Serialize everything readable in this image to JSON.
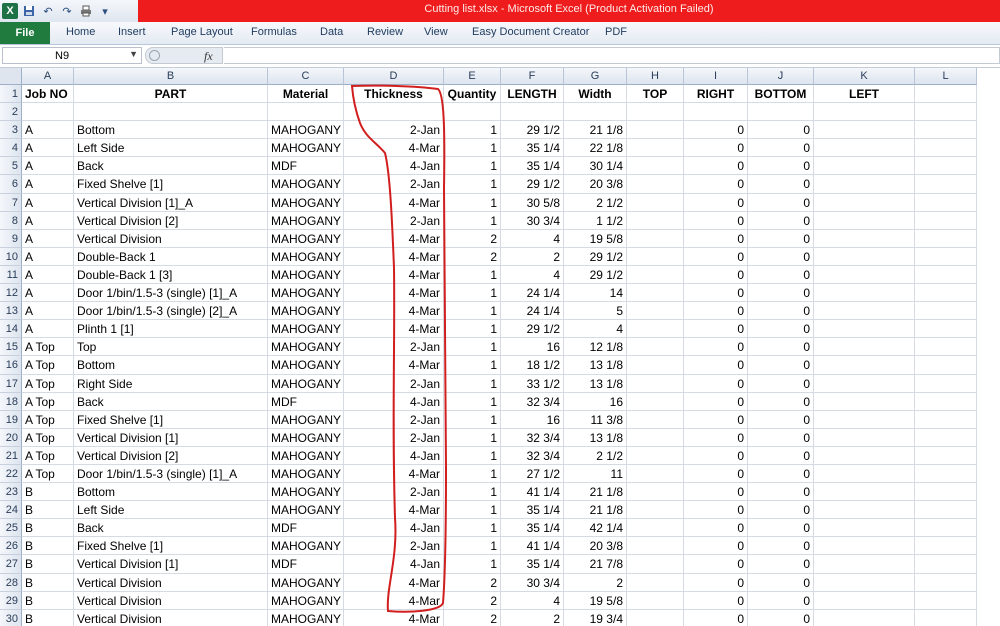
{
  "window": {
    "title": "Cutting list.xlsx  -  Microsoft Excel (Product Activation Failed)"
  },
  "app": {
    "logo": "X"
  },
  "qat": {
    "icons": [
      "save-icon",
      "undo-icon",
      "redo-icon",
      "print-icon",
      "customize-icon"
    ]
  },
  "ribbon": {
    "file": "File",
    "tabs": [
      "Home",
      "Insert",
      "Page Layout",
      "Formulas",
      "Data",
      "Review",
      "View",
      "Easy Document Creator",
      "PDF"
    ]
  },
  "formula_bar": {
    "name_box": "N9",
    "fx": "fx",
    "value": ""
  },
  "columns": [
    "A",
    "B",
    "C",
    "D",
    "E",
    "F",
    "G",
    "H",
    "I",
    "J",
    "K",
    "L"
  ],
  "header_row": [
    "Job NO",
    "PART",
    "Material",
    "Thickness",
    "Quantity",
    "LENGTH",
    "Width",
    "TOP",
    "RIGHT",
    "BOTTOM",
    "LEFT",
    ""
  ],
  "rows": [
    {
      "n": "1"
    },
    {
      "n": "2",
      "cells": [
        "",
        "",
        "",
        "",
        "",
        "",
        "",
        "",
        "",
        "",
        "",
        ""
      ]
    },
    {
      "n": "3",
      "cells": [
        "A",
        "Bottom",
        "MAHOGANY",
        "2-Jan",
        "1",
        "29 1/2",
        "21 1/8",
        "",
        "0",
        "0",
        "",
        ""
      ]
    },
    {
      "n": "4",
      "cells": [
        "A",
        "Left Side",
        "MAHOGANY",
        "4-Mar",
        "1",
        "35 1/4",
        "22 1/8",
        "",
        "0",
        "0",
        "",
        ""
      ]
    },
    {
      "n": "5",
      "cells": [
        "A",
        "Back",
        "MDF",
        "4-Jan",
        "1",
        "35 1/4",
        "30 1/4",
        "",
        "0",
        "0",
        "",
        ""
      ]
    },
    {
      "n": "6",
      "cells": [
        "A",
        "Fixed Shelve [1]",
        "MAHOGANY",
        "2-Jan",
        "1",
        "29 1/2",
        "20 3/8",
        "",
        "0",
        "0",
        "",
        ""
      ]
    },
    {
      "n": "7",
      "cells": [
        "A",
        "Vertical Division [1]_A",
        "MAHOGANY",
        "4-Mar",
        "1",
        "30 5/8",
        "2 1/2",
        "",
        "0",
        "0",
        "",
        ""
      ]
    },
    {
      "n": "8",
      "cells": [
        "A",
        "Vertical Division [2]",
        "MAHOGANY",
        "2-Jan",
        "1",
        "30 3/4",
        "1 1/2",
        "",
        "0",
        "0",
        "",
        ""
      ]
    },
    {
      "n": "9",
      "cells": [
        "A",
        "Vertical Division",
        "MAHOGANY",
        "4-Mar",
        "2",
        "4",
        "19 5/8",
        "",
        "0",
        "0",
        "",
        ""
      ]
    },
    {
      "n": "10",
      "cells": [
        "A",
        "Double-Back 1",
        "MAHOGANY",
        "4-Mar",
        "2",
        "2",
        "29 1/2",
        "",
        "0",
        "0",
        "",
        ""
      ]
    },
    {
      "n": "11",
      "cells": [
        "A",
        "Double-Back 1 [3]",
        "MAHOGANY",
        "4-Mar",
        "1",
        "4",
        "29 1/2",
        "",
        "0",
        "0",
        "",
        ""
      ]
    },
    {
      "n": "12",
      "cells": [
        "A",
        "Door 1/bin/1.5-3 (single) [1]_A",
        "MAHOGANY",
        "4-Mar",
        "1",
        "24 1/4",
        "14",
        "",
        "0",
        "0",
        "",
        ""
      ]
    },
    {
      "n": "13",
      "cells": [
        "A",
        "Door 1/bin/1.5-3 (single) [2]_A",
        "MAHOGANY",
        "4-Mar",
        "1",
        "24 1/4",
        "5",
        "",
        "0",
        "0",
        "",
        ""
      ]
    },
    {
      "n": "14",
      "cells": [
        "A",
        "Plinth 1 [1]",
        "MAHOGANY",
        "4-Mar",
        "1",
        "29 1/2",
        "4",
        "",
        "0",
        "0",
        "",
        ""
      ]
    },
    {
      "n": "15",
      "cells": [
        "A Top",
        "Top",
        "MAHOGANY",
        "2-Jan",
        "1",
        "16",
        "12 1/8",
        "",
        "0",
        "0",
        "",
        ""
      ]
    },
    {
      "n": "16",
      "cells": [
        "A Top",
        "Bottom",
        "MAHOGANY",
        "4-Mar",
        "1",
        "18 1/2",
        "13 1/8",
        "",
        "0",
        "0",
        "",
        ""
      ]
    },
    {
      "n": "17",
      "cells": [
        "A Top",
        "Right Side",
        "MAHOGANY",
        "2-Jan",
        "1",
        "33 1/2",
        "13 1/8",
        "",
        "0",
        "0",
        "",
        ""
      ]
    },
    {
      "n": "18",
      "cells": [
        "A Top",
        "Back",
        "MDF",
        "4-Jan",
        "1",
        "32 3/4",
        "16",
        "",
        "0",
        "0",
        "",
        ""
      ]
    },
    {
      "n": "19",
      "cells": [
        "A Top",
        "Fixed Shelve [1]",
        "MAHOGANY",
        "2-Jan",
        "1",
        "16",
        "11 3/8",
        "",
        "0",
        "0",
        "",
        ""
      ]
    },
    {
      "n": "20",
      "cells": [
        "A Top",
        "Vertical Division [1]",
        "MAHOGANY",
        "2-Jan",
        "1",
        "32 3/4",
        "13 1/8",
        "",
        "0",
        "0",
        "",
        ""
      ]
    },
    {
      "n": "21",
      "cells": [
        "A Top",
        "Vertical Division [2]",
        "MAHOGANY",
        "4-Jan",
        "1",
        "32 3/4",
        "2 1/2",
        "",
        "0",
        "0",
        "",
        ""
      ]
    },
    {
      "n": "22",
      "cells": [
        "A Top",
        "Door 1/bin/1.5-3 (single) [1]_A",
        "MAHOGANY",
        "4-Mar",
        "1",
        "27 1/2",
        "11",
        "",
        "0",
        "0",
        "",
        ""
      ]
    },
    {
      "n": "23",
      "cells": [
        "B",
        "Bottom",
        "MAHOGANY",
        "2-Jan",
        "1",
        "41 1/4",
        "21 1/8",
        "",
        "0",
        "0",
        "",
        ""
      ]
    },
    {
      "n": "24",
      "cells": [
        "B",
        "Left Side",
        "MAHOGANY",
        "4-Mar",
        "1",
        "35 1/4",
        "21 1/8",
        "",
        "0",
        "0",
        "",
        ""
      ]
    },
    {
      "n": "25",
      "cells": [
        "B",
        "Back",
        "MDF",
        "4-Jan",
        "1",
        "35 1/4",
        "42 1/4",
        "",
        "0",
        "0",
        "",
        ""
      ]
    },
    {
      "n": "26",
      "cells": [
        "B",
        "Fixed Shelve [1]",
        "MAHOGANY",
        "2-Jan",
        "1",
        "41 1/4",
        "20 3/8",
        "",
        "0",
        "0",
        "",
        ""
      ]
    },
    {
      "n": "27",
      "cells": [
        "B",
        "Vertical Division [1]",
        "MDF",
        "4-Jan",
        "1",
        "35 1/4",
        "21 7/8",
        "",
        "0",
        "0",
        "",
        ""
      ]
    },
    {
      "n": "28",
      "cells": [
        "B",
        "Vertical Division",
        "MAHOGANY",
        "4-Mar",
        "2",
        "30 3/4",
        "2",
        "",
        "0",
        "0",
        "",
        ""
      ]
    },
    {
      "n": "29",
      "cells": [
        "B",
        "Vertical Division",
        "MAHOGANY",
        "4-Mar",
        "2",
        "4",
        "19 5/8",
        "",
        "0",
        "0",
        "",
        ""
      ]
    },
    {
      "n": "30",
      "cells": [
        "B",
        "Vertical Division",
        "MAHOGANY",
        "4-Mar",
        "2",
        "2",
        "19 3/4",
        "",
        "0",
        "0",
        "",
        ""
      ]
    }
  ],
  "colors": {
    "title_bar": "#ee1c1c",
    "file_tab": "#1f7b3e",
    "annotation": "#d11f1f"
  }
}
